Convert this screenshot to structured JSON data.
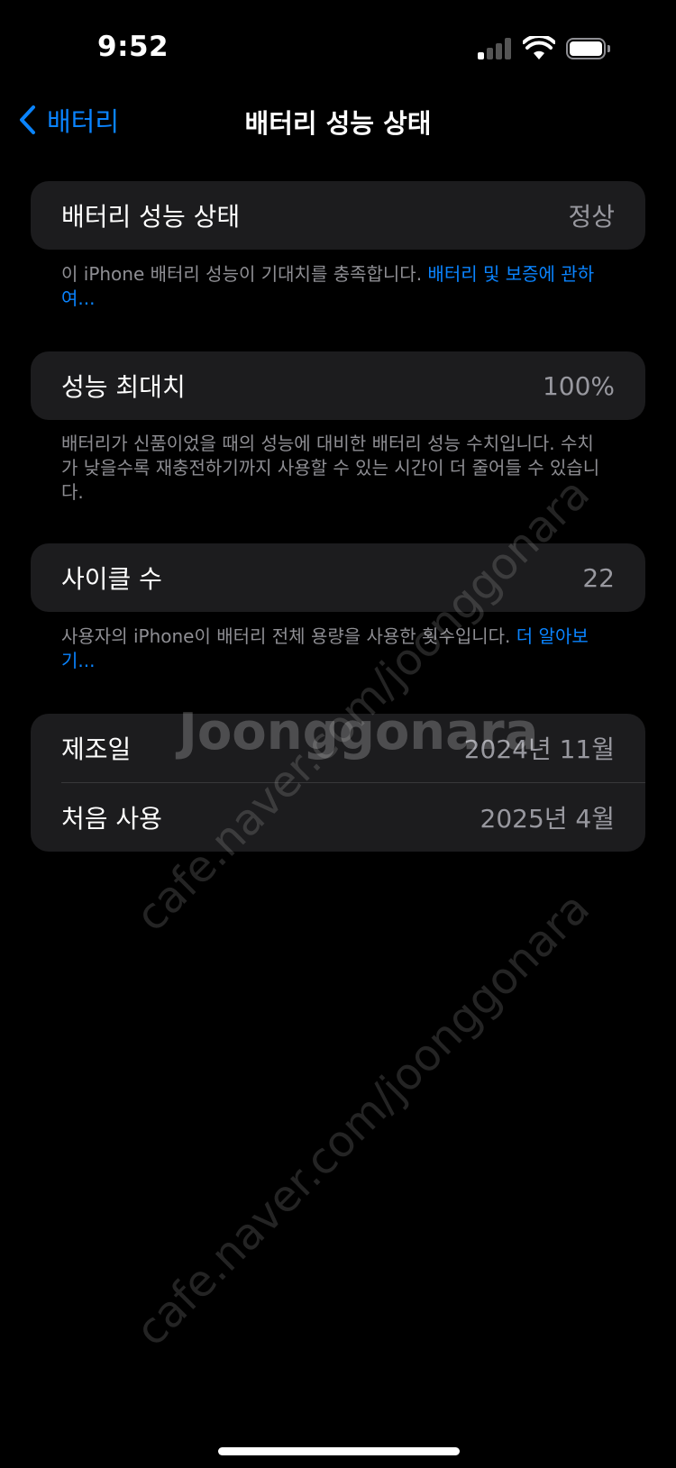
{
  "status": {
    "time": "9:52"
  },
  "nav": {
    "back_label": "배터리",
    "title": "배터리 성능 상태"
  },
  "health": {
    "label": "배터리 성능 상태",
    "value": "정상"
  },
  "health_note": {
    "text": "이 iPhone 배터리 성능이 기대치를 충족합니다. ",
    "link": "배터리 및 보증에 관하여..."
  },
  "capacity": {
    "label": "성능 최대치",
    "value": "100%"
  },
  "capacity_note": {
    "text": "배터리가 신품이었을 때의 성능에 대비한 배터리 성능 수치입니다. 수치가 낮을수록 재충전하기까지 사용할 수 있는 시간이 더 줄어들 수 있습니다."
  },
  "cycle": {
    "label": "사이클 수",
    "value": "22"
  },
  "cycle_note": {
    "text": "사용자의 iPhone이 배터리 전체 용량을 사용한 횟수입니다. ",
    "link": "더 알아보기..."
  },
  "dates": {
    "manufactured_label": "제조일",
    "manufactured_value": "2024년 11월",
    "first_use_label": "처음 사용",
    "first_use_value": "2025년 4월"
  },
  "watermark": {
    "url": "cafe.naver.com/joonggonara",
    "logo": "Joonggonara"
  },
  "colors": {
    "accent": "#0a84ff",
    "card": "#1c1c1e",
    "secondary_text": "#8e8e93"
  }
}
